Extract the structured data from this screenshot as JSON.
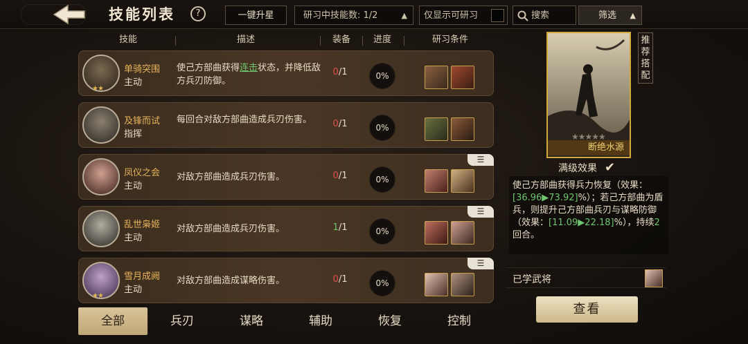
{
  "header": {
    "title": "技能列表",
    "help": "?",
    "upgrade": "一键升星",
    "studying_label": "研习中技能数:",
    "studying_value": "1/2",
    "only_label": "仅显示可研习",
    "search_placeholder": "搜索",
    "filter": "筛选"
  },
  "columns": {
    "skill": "技能",
    "desc": "描述",
    "equip": "装备",
    "progress": "进度",
    "cond": "研习条件"
  },
  "skills": [
    {
      "name": "单骑突围",
      "type": "主动",
      "desc_a": "使己方部曲获得",
      "desc_hl": "连击",
      "desc_b": "状态，并降低敌方兵刃防御。",
      "equip_cur": "0",
      "equip_max": "/1",
      "progress": "0%",
      "stars": "★★"
    },
    {
      "name": "及锋而试",
      "type": "指挥",
      "desc_a": "每回合对敌方部曲造成兵刃伤害。",
      "desc_hl": "",
      "desc_b": "",
      "equip_cur": "0",
      "equip_max": "/1",
      "progress": "0%",
      "stars": ""
    },
    {
      "name": "凤仪之会",
      "type": "主动",
      "desc_a": "对敌方部曲造成兵刃伤害。",
      "desc_hl": "",
      "desc_b": "",
      "equip_cur": "0",
      "equip_max": "/1",
      "progress": "0%",
      "stars": ""
    },
    {
      "name": "乱世枭姬",
      "type": "主动",
      "desc_a": "对敌方部曲造成兵刃伤害。",
      "desc_hl": "",
      "desc_b": "",
      "equip_cur": "1",
      "equip_max": "/1",
      "progress": "0%",
      "stars": ""
    },
    {
      "name": "雪月成阙",
      "type": "主动",
      "desc_a": "对敌方部曲造成谋略伤害。",
      "desc_hl": "",
      "desc_b": "",
      "equip_cur": "0",
      "equip_max": "/1",
      "progress": "0%",
      "stars": "★★"
    }
  ],
  "tabs": [
    "全部",
    "兵刃",
    "谋略",
    "辅助",
    "恢复",
    "控制"
  ],
  "detail": {
    "card_name": "断绝水源",
    "card_stars": "★★★★★",
    "recommend": "推荐搭配",
    "max_label": "满级效果",
    "effect_a": "使己方部曲获得兵力恢复（效果：",
    "effect_v1": "[36.96▶73.92]",
    "effect_b": "%）；若己方部曲为盾兵，则提升己方部曲兵刃与谋略防御（效果：",
    "effect_v2": "[11.09▶22.18]",
    "effect_c": "%），持续",
    "effect_v3": "2",
    "effect_d": "回合。",
    "learned": "已学武将",
    "view": "查看"
  },
  "colors": {
    "accent": "#e6b45a",
    "green": "#6fc56f",
    "red": "#e05050",
    "gold_border": "#d4a93b"
  }
}
